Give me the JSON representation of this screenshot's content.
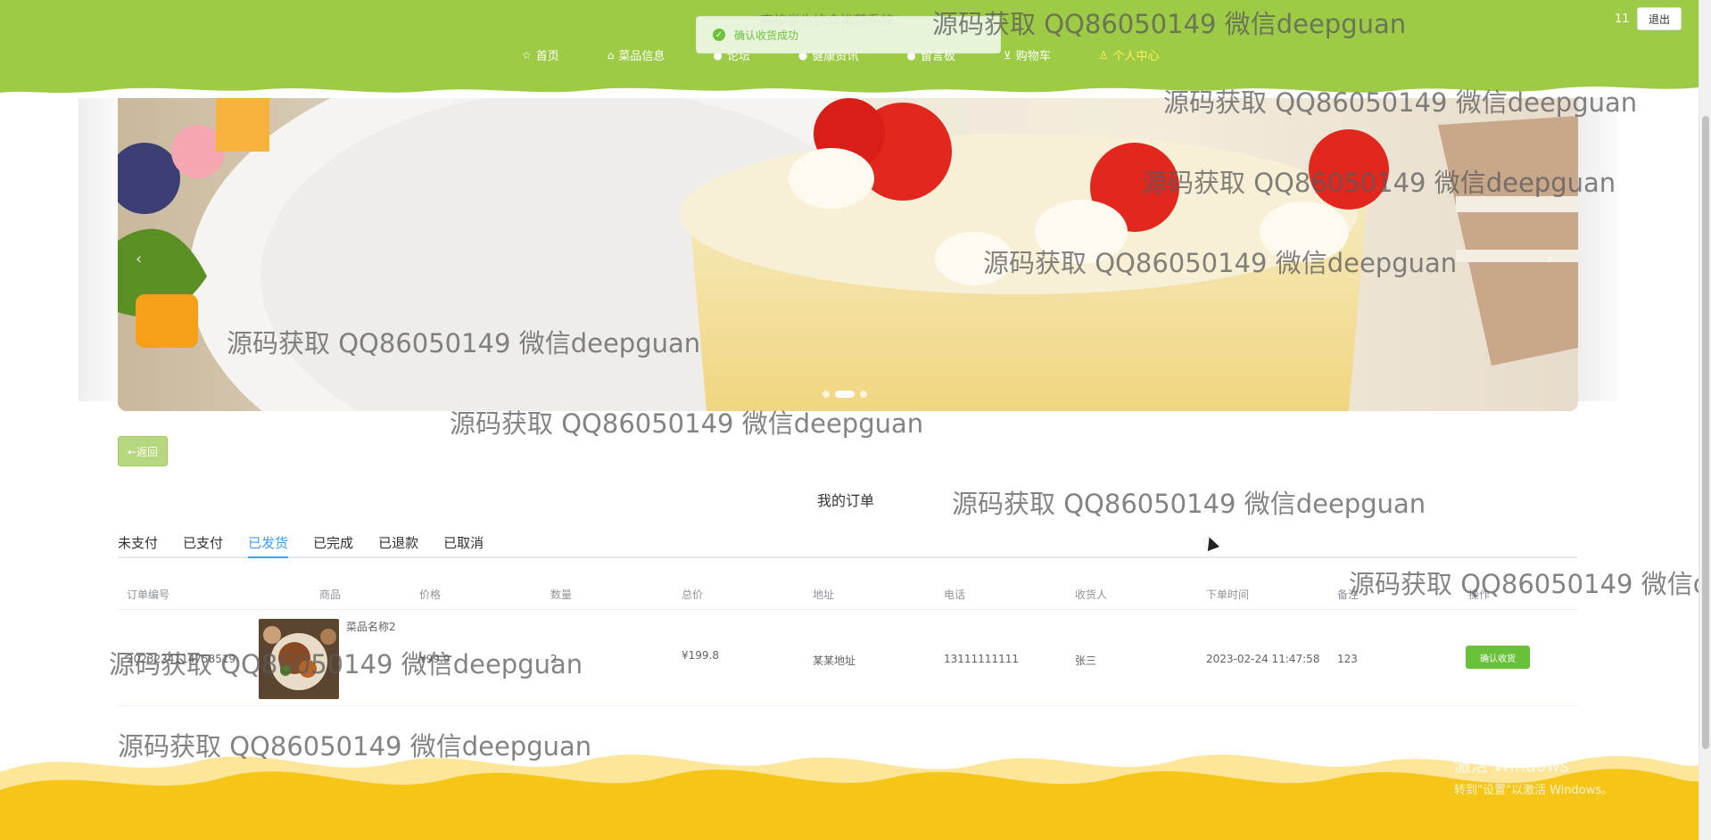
{
  "header": {
    "site_title": "高校学生饮食推荐系统",
    "nav": [
      {
        "label": "首页",
        "icon": "star-icon"
      },
      {
        "label": "菜品信息",
        "icon": "bag-icon"
      },
      {
        "label": "论坛",
        "icon": "dot-icon"
      },
      {
        "label": "健康资讯",
        "icon": "dot-icon"
      },
      {
        "label": "留言板",
        "icon": "dot-icon"
      },
      {
        "label": "购物车",
        "icon": "cart-icon"
      },
      {
        "label": "个人中心",
        "icon": "user-icon"
      }
    ],
    "user": "11",
    "logout": "退出",
    "toast": "确认收货成功"
  },
  "banner": {
    "prev": "‹",
    "next": "›"
  },
  "back_button": "←返回",
  "section_title": "我的订单",
  "tabs": [
    "未支付",
    "已支付",
    "已发货",
    "已完成",
    "已退款",
    "已取消"
  ],
  "active_tab": "已发货",
  "table": {
    "headers": [
      "订单编号",
      "商品",
      "价格",
      "数量",
      "总价",
      "地址",
      "电话",
      "收货人",
      "下单时间",
      "备注",
      "操作"
    ],
    "rows": [
      {
        "order_no": "2023224114758519",
        "product_name": "菜品名称2",
        "price": "¥99.9",
        "quantity": "2",
        "total": "¥199.8",
        "address": "某某地址",
        "phone": "13111111111",
        "receiver": "张三",
        "order_time": "2023-02-24 11:47:58",
        "note": "123",
        "action": "确认收货"
      }
    ]
  },
  "watermark": "源码获取 QQ86050149 微信deepguan",
  "windows_activation": {
    "title": "激活 Windows",
    "subtitle": "转到\"设置\"以激活 Windows。"
  },
  "colors": {
    "nav_green": "#9dcb45",
    "footer_yellow": "#f5c518",
    "success_green": "#67c23a",
    "tab_active": "#409eff"
  }
}
